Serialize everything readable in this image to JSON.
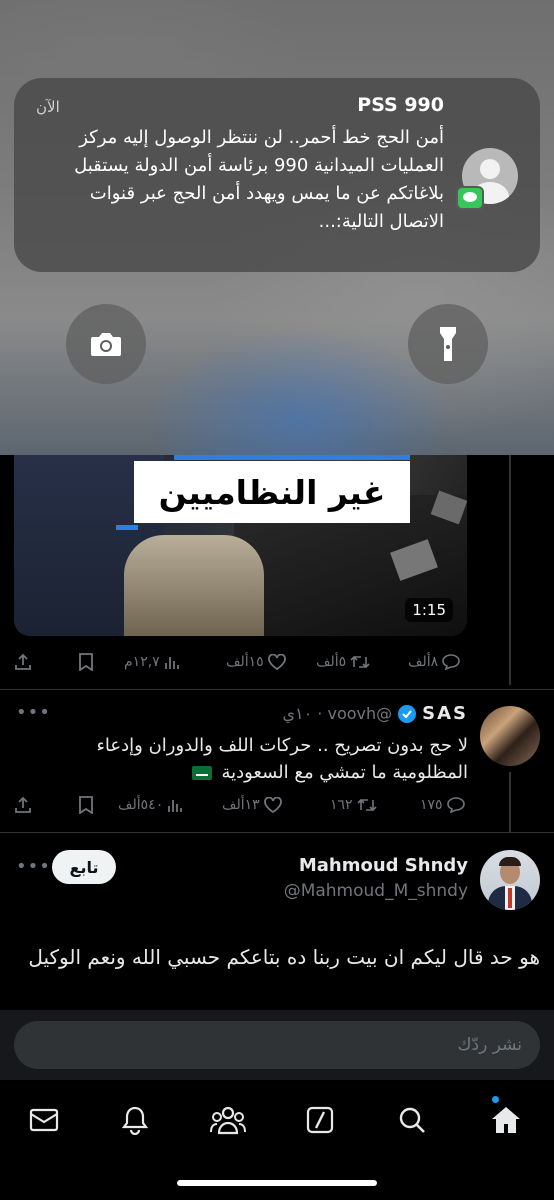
{
  "notification": {
    "title": "PSS 990",
    "time": "الآن",
    "text": "أمن الحج خط أحمر.. لن ننتظر الوصول إليه مركز العمليات الميدانية 990 برئاسة أمن الدولة يستقبل بلاغاتكم عن ما يمس ويهدد أمن الحج عبر قنوات الاتصال التالية:..."
  },
  "lock_controls": {
    "camera_icon": "camera-icon",
    "flashlight_icon": "flashlight-icon"
  },
  "video_tweet": {
    "video_caption": "غير النظاميين",
    "duration": "1:15",
    "replies": "٨ألف",
    "retweets": "٥ألف",
    "likes": "١٥ألف",
    "views": "١٢,٧م"
  },
  "reply_tweet": {
    "name": "SAS",
    "handle_time": "@voovh · ١٠ي",
    "line1": "لا حج بدون تصريح .. حركات اللف والدوران وإدعاء",
    "line2": "المظلومية ما تمشي مع السعودية",
    "replies": "١٧٥",
    "retweets": "١٦٢",
    "likes": "١٣ألف",
    "views": "٥٤٠ألف"
  },
  "main_tweet": {
    "name": "Mahmoud Shndy",
    "handle": "@Mahmoud_M_shndy",
    "follow_label": "تابع",
    "text": "هو حد قال ليكم ان بيت ربنا ده بتاعكم حسبي الله ونعم الوكيل"
  },
  "composer": {
    "placeholder": "نشر ردّك"
  },
  "nav": [
    "mail-icon",
    "bell-icon",
    "people-icon",
    "compose-icon",
    "search-icon",
    "home-icon"
  ],
  "colors": {
    "accent": "#1d9bf0",
    "background": "#000000",
    "muted": "#71767b"
  }
}
